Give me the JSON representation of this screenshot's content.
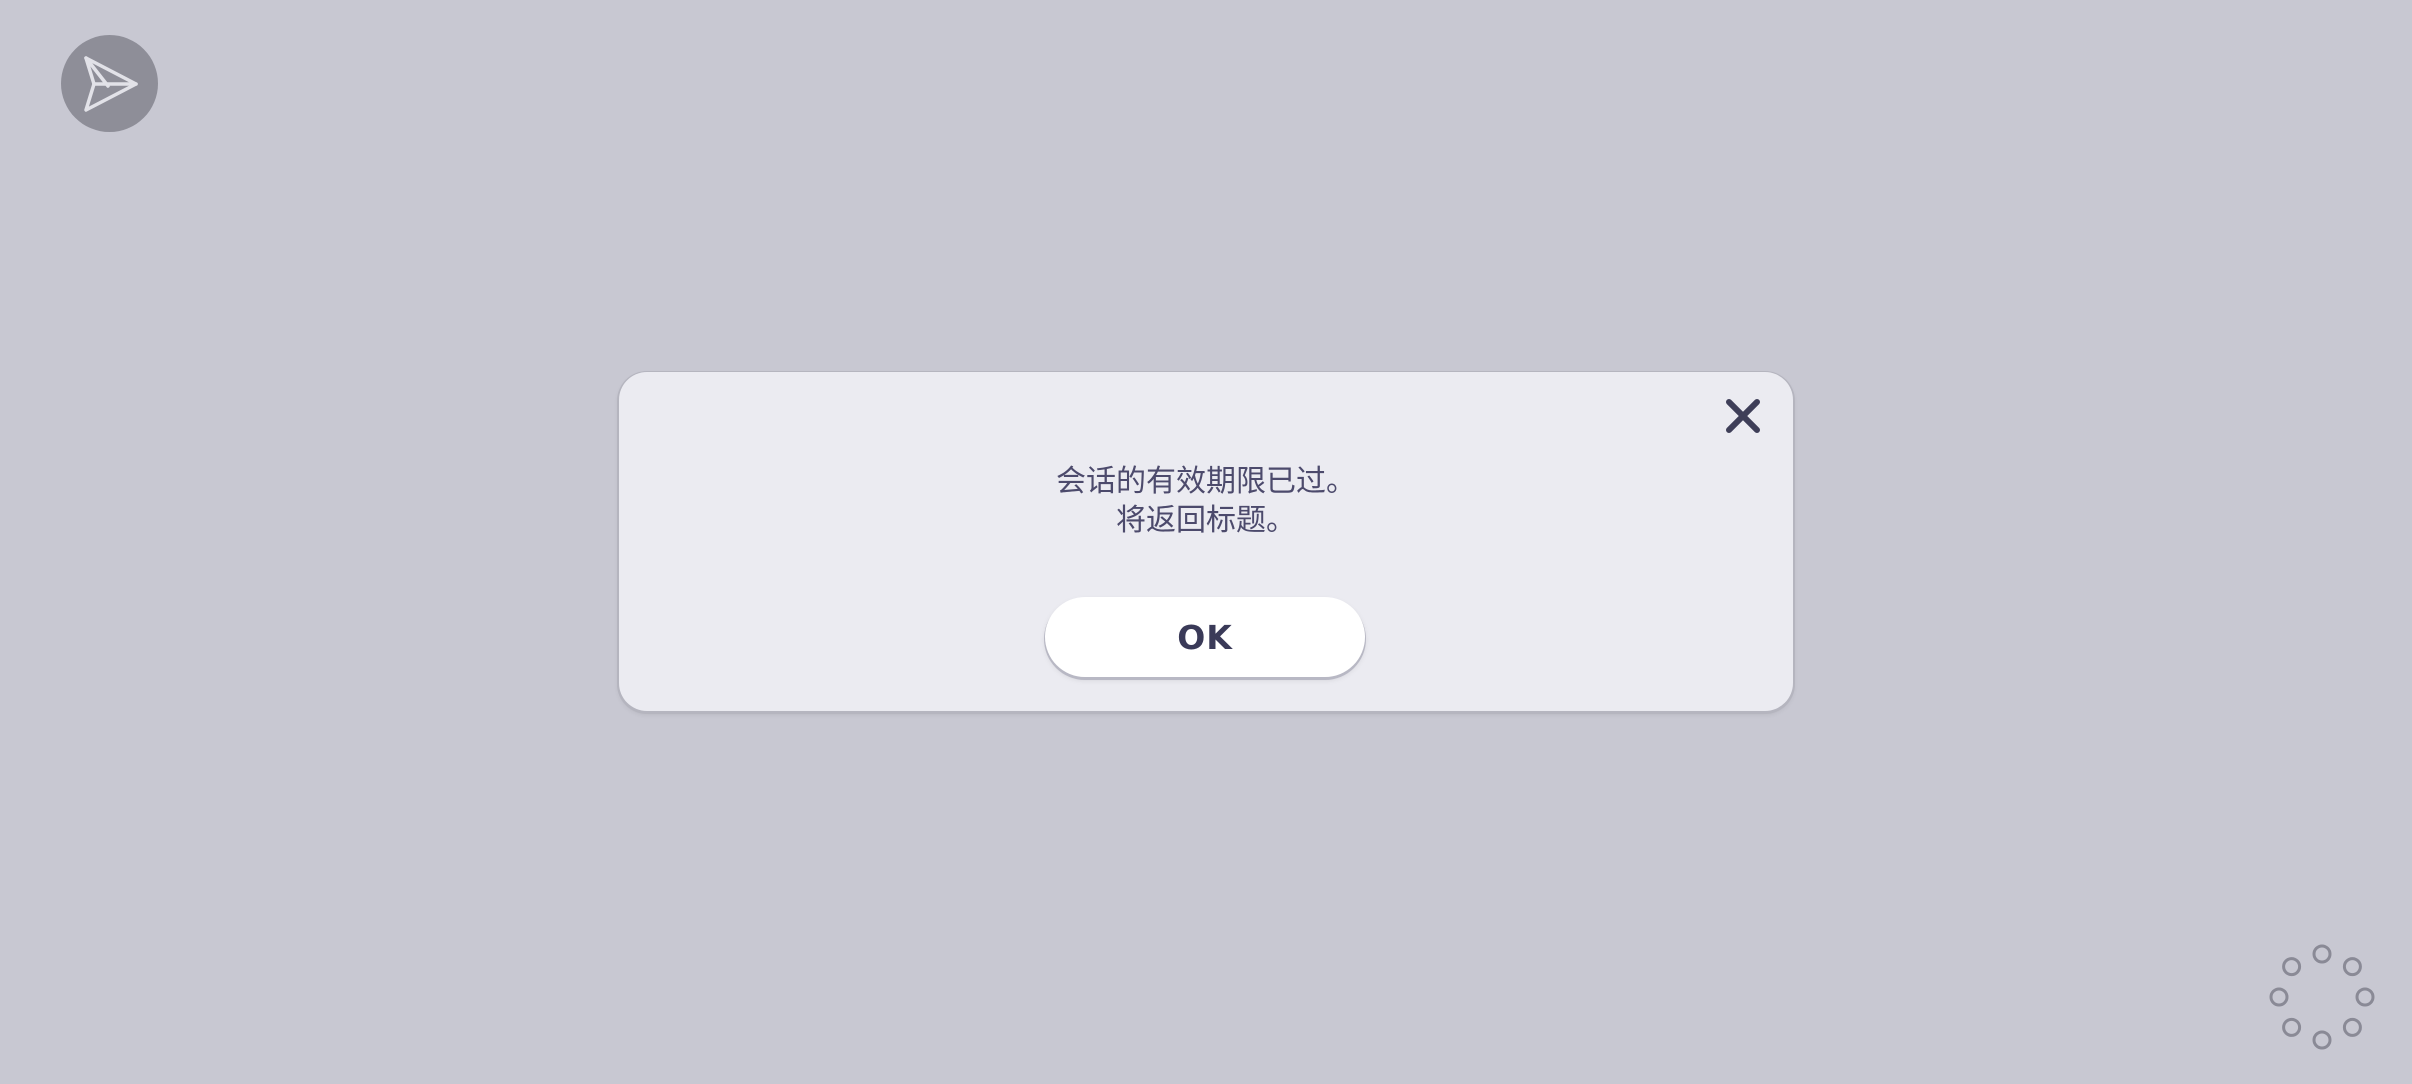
{
  "share": {
    "icon": "paper-plane-icon"
  },
  "dialog": {
    "close_icon": "close-icon",
    "message_line_1": "会话的有效期限已过。",
    "message_line_2": "将返回标题。",
    "ok_label": "OK"
  },
  "loading": {
    "icon": "loading-spinner-icon"
  },
  "colors": {
    "background": "#c8c8d2",
    "dialog_background": "#ebebf1",
    "text": "#4c4a6c",
    "button_text": "#3a3a58",
    "share_button_background": "#8e8e98"
  }
}
